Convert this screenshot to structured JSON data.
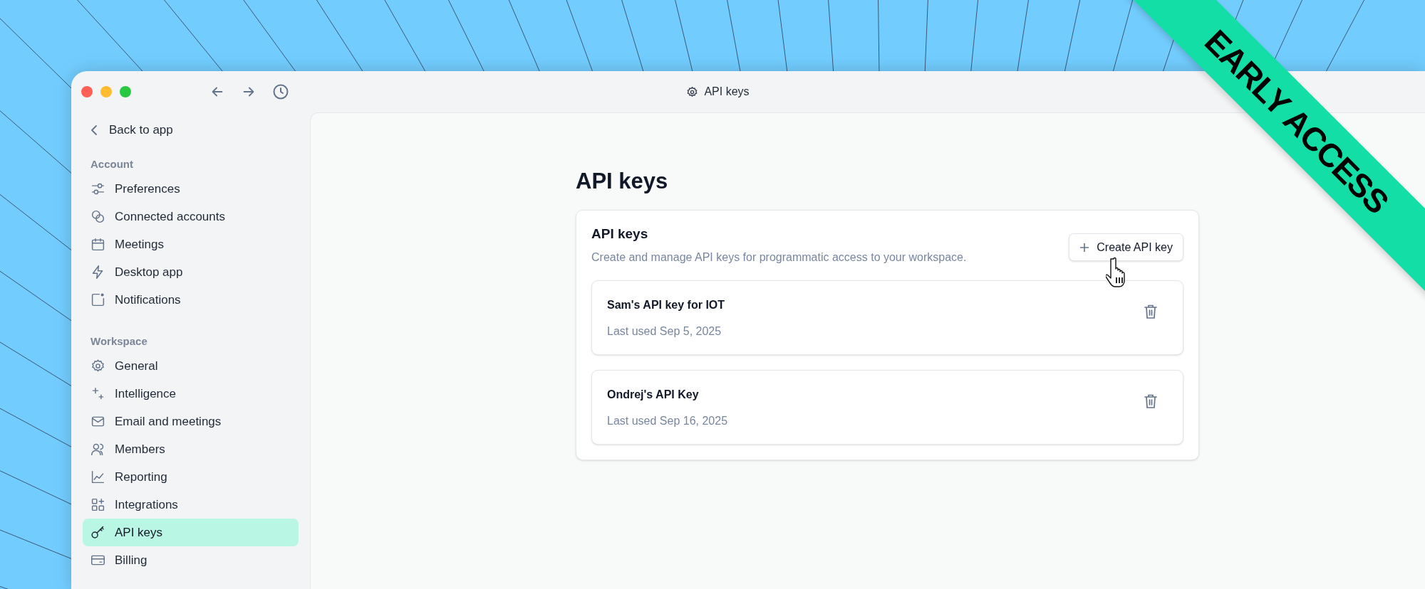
{
  "window": {
    "title": "API keys"
  },
  "sidebar": {
    "back_link": "Back to app",
    "sections": [
      {
        "heading": "Account",
        "items": [
          {
            "label": "Preferences",
            "selected": false
          },
          {
            "label": "Connected accounts",
            "selected": false
          },
          {
            "label": "Meetings",
            "selected": false
          },
          {
            "label": "Desktop app",
            "selected": false
          },
          {
            "label": "Notifications",
            "selected": false
          }
        ]
      },
      {
        "heading": "Workspace",
        "items": [
          {
            "label": "General",
            "selected": false
          },
          {
            "label": "Intelligence",
            "selected": false
          },
          {
            "label": "Email and meetings",
            "selected": false
          },
          {
            "label": "Members",
            "selected": false
          },
          {
            "label": "Reporting",
            "selected": false
          },
          {
            "label": "Integrations",
            "selected": false
          },
          {
            "label": "API keys",
            "selected": true
          },
          {
            "label": "Billing",
            "selected": false
          }
        ]
      }
    ]
  },
  "main": {
    "heading": "API keys",
    "card": {
      "title": "API keys",
      "description": "Create and manage API keys for programmatic access to your workspace.",
      "create_button": "Create API key",
      "keys": [
        {
          "name": "Sam's API key for IOT",
          "last_used": "Last used Sep 5, 2025"
        },
        {
          "name": "Ondrej's API Key",
          "last_used": "Last used Sep 16, 2025"
        }
      ]
    }
  },
  "ribbon": {
    "label": "EARLY ACCESS"
  }
}
